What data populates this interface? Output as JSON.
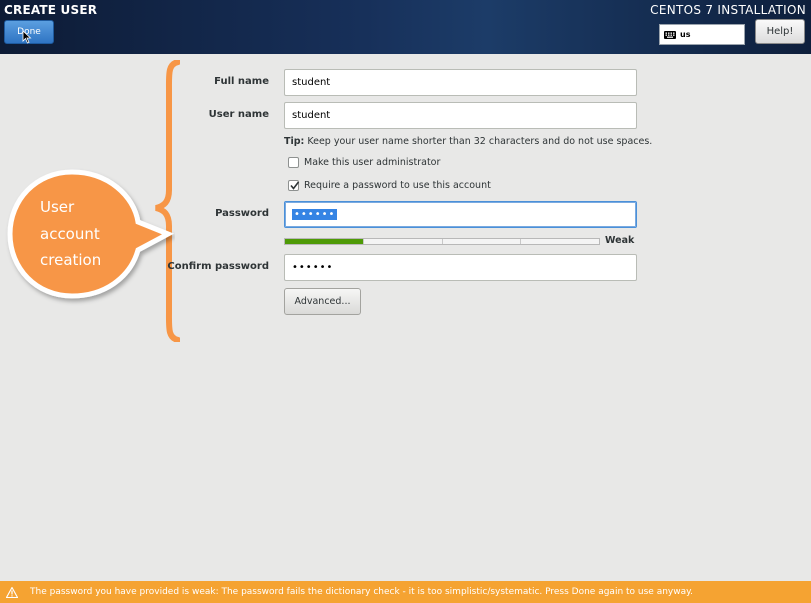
{
  "header": {
    "title": "CREATE USER",
    "product": "CENTOS 7 INSTALLATION",
    "done_label": "Done",
    "keyboard_layout": "us",
    "help_label": "Help!"
  },
  "form": {
    "fullname_label": "Full name",
    "fullname_value": "student",
    "username_label": "User name",
    "username_value": "student",
    "tip_prefix": "Tip:",
    "tip_text": " Keep your user name shorter than 32 characters and do not use spaces.",
    "admin_label": "Make this user administrator",
    "admin_checked": false,
    "require_pw_label": "Require a password to use this account",
    "require_pw_checked": true,
    "password_label": "Password",
    "password_value": "••••••",
    "strength_fraction": 0.25,
    "strength_label": "Weak",
    "confirm_label": "Confirm password",
    "confirm_value": "••••••",
    "advanced_label": "Advanced..."
  },
  "annotation": {
    "line1": "User",
    "line2": "account",
    "line3": "creation"
  },
  "warning": {
    "text": "The password you have provided is weak: The password fails the dictionary check - it is too simplistic/systematic. Press Done again to use anyway."
  },
  "colors": {
    "header_bg": "#17305a",
    "done_button": "#3a82d0",
    "warning_bar": "#f5a332",
    "callout": "#f79646",
    "strength_fill": "#4e9a06"
  }
}
